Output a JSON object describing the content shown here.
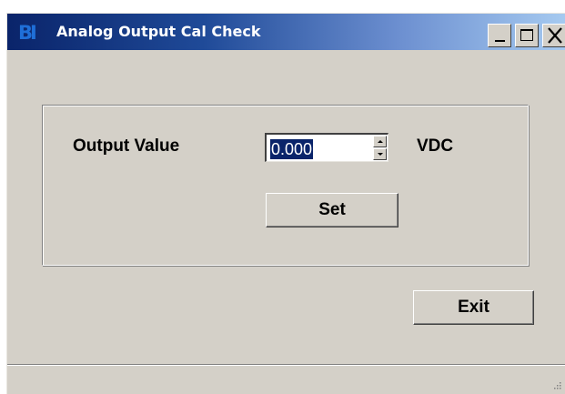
{
  "window": {
    "title": "Analog Output Cal Check",
    "logo_text": "BI",
    "controls": {
      "minimize": "minimize-icon",
      "maximize": "maximize-icon",
      "close": "close-icon"
    }
  },
  "form": {
    "output_label": "Output Value",
    "output_value": "0.000",
    "unit": "VDC",
    "set_label": "Set"
  },
  "footer": {
    "exit_label": "Exit"
  },
  "colors": {
    "titlebar_start": "#0a246a",
    "titlebar_end": "#a6caf0",
    "face": "#d4d0c8",
    "selection": "#0a246a"
  }
}
